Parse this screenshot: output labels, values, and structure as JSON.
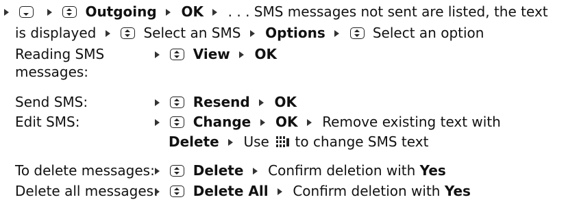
{
  "intro": {
    "outgoing": "Outgoing",
    "ok": "OK",
    "listed_text": ". . . SMS messages not sent are listed, the text",
    "displayed_text": "is displayed",
    "select_sms": "Select an SMS",
    "options": "Options",
    "select_option": "Select an option"
  },
  "rows": [
    {
      "label_line1": "Reading SMS",
      "label_line2": "messages:",
      "action": "View",
      "ok": "OK"
    },
    {
      "label": "Send SMS:",
      "action": "Resend",
      "ok": "OK"
    },
    {
      "label": "Edit SMS:",
      "action": "Change",
      "ok": "OK",
      "rest": "Remove existing text with",
      "delete": "Delete",
      "use": "Use",
      "change_text": "to change SMS text"
    },
    {
      "label": "To delete messages:",
      "action": "Delete",
      "confirm": "Confirm deletion with",
      "yes": "Yes"
    },
    {
      "label": "Delete all messages:",
      "action": "Delete All",
      "confirm": "Confirm deletion with",
      "yes": "Yes"
    }
  ],
  "icons": [
    "triangle-bullet-icon",
    "key-down-icon",
    "key-up-down-icon",
    "keypad-icon"
  ]
}
